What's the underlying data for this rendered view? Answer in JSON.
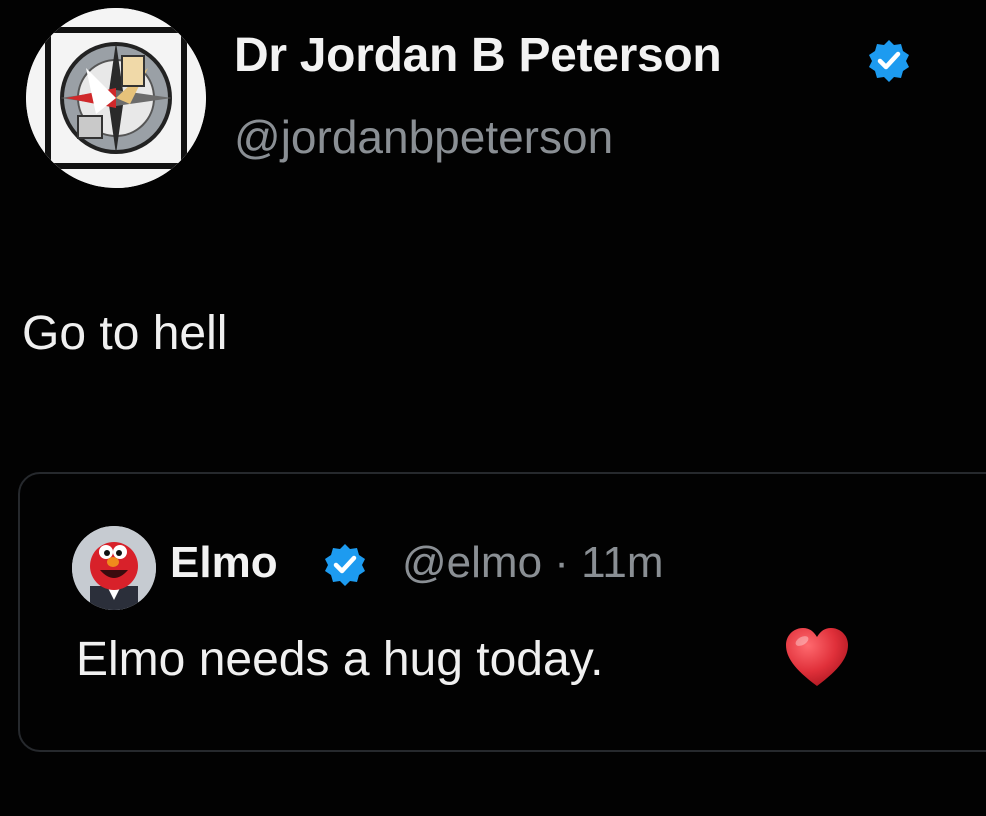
{
  "tweet": {
    "author": {
      "name": "Dr Jordan B Peterson",
      "handle": "@jordanbpeterson",
      "verified": true,
      "avatar_icon": "compass-logo-avatar"
    },
    "text": "Go to hell"
  },
  "quoted_tweet": {
    "author": {
      "name": "Elmo",
      "handle_time": "@elmo · 11m",
      "verified": true,
      "avatar_icon": "elmo-avatar"
    },
    "text": "Elmo needs a hug today.",
    "emoji_icon": "red-heart-icon"
  },
  "colors": {
    "background": "#020202",
    "verified_blue": "#1d9bf0",
    "handle_gray": "#8a8f94",
    "heart_red": "#e0303a"
  }
}
